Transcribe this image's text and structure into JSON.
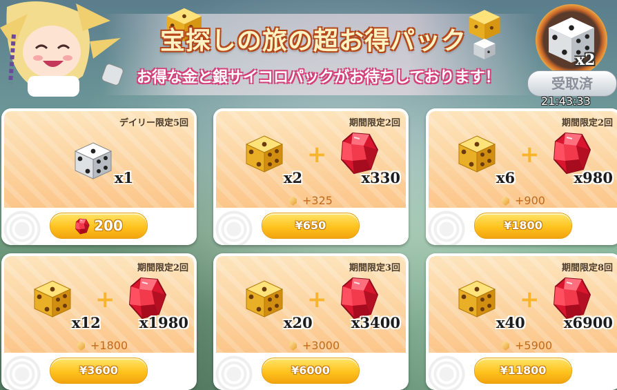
{
  "header": {
    "title": "宝探しの旅の超お得パック",
    "subtitle": "お得な金と銀サイコロパックがお待ちしております！",
    "claim": {
      "count": "x2",
      "button_label": "受取済",
      "timer": "21:43:33"
    }
  },
  "packs": [
    {
      "limit": "デイリー限定5回",
      "die": "silver",
      "die_qty": "x1",
      "gem_qty": "",
      "bonus": "",
      "price": "200",
      "price_type": "gem"
    },
    {
      "limit": "期間限定2回",
      "die": "gold",
      "die_qty": "x2",
      "gem_qty": "x330",
      "bonus": "+325",
      "price": "¥650",
      "price_type": "yen"
    },
    {
      "limit": "期間限定2回",
      "die": "gold",
      "die_qty": "x6",
      "gem_qty": "x980",
      "bonus": "+900",
      "price": "¥1800",
      "price_type": "yen"
    },
    {
      "limit": "期間限定2回",
      "die": "gold",
      "die_qty": "x12",
      "gem_qty": "x1980",
      "bonus": "+1800",
      "price": "¥3600",
      "price_type": "yen"
    },
    {
      "limit": "期間限定3回",
      "die": "gold",
      "die_qty": "x20",
      "gem_qty": "x3400",
      "bonus": "+3000",
      "price": "¥6000",
      "price_type": "yen"
    },
    {
      "limit": "期間限定8回",
      "die": "gold",
      "die_qty": "x40",
      "gem_qty": "x6900",
      "bonus": "+5900",
      "price": "¥11800",
      "price_type": "yen"
    }
  ],
  "plus_symbol": "+",
  "colors": {
    "gold_die": "#f5c43b",
    "silver_die": "#e9ecef",
    "gem": "#e3233b",
    "price_button": "#ffc31f",
    "bonus_text": "#c06a1c"
  },
  "icons": {
    "die": "dice-icon",
    "gem": "ruby-gem-icon",
    "bonus": "small-gem-icon"
  }
}
